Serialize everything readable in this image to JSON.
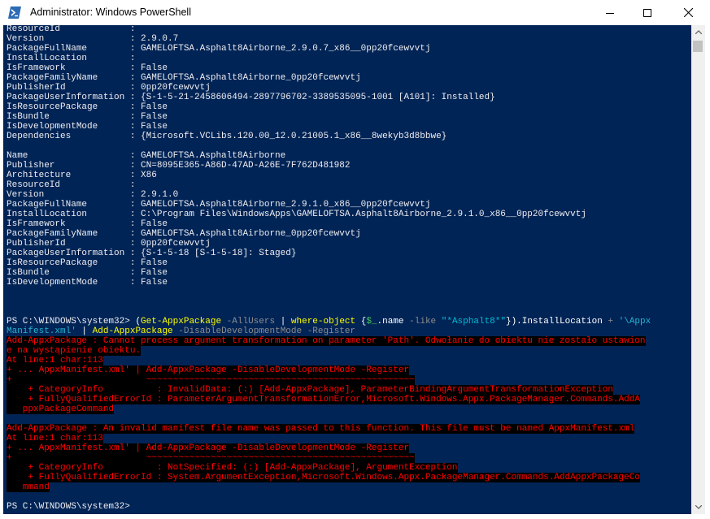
{
  "window": {
    "title": "Administrator: Windows PowerShell",
    "icon": "powershell-icon",
    "controls": {
      "minimize": "minimize-icon",
      "maximize": "maximize-icon",
      "close": "close-icon"
    }
  },
  "colors": {
    "console_bg": "#012456",
    "text": "#eeedf0",
    "error_fg": "#ff0000",
    "error_bg": "#000000",
    "cmdlet": "#ffff00",
    "parameter": "#8c8c8c",
    "string": "#00bcd4",
    "variable": "#44c35e"
  },
  "package1": {
    "lines": [
      "ResourceId             :",
      "Version                : 2.9.0.7",
      "PackageFullName        : GAMELOFTSA.Asphalt8Airborne_2.9.0.7_x86__0pp20fcewvvtj",
      "InstallLocation        :",
      "IsFramework            : False",
      "PackageFamilyName      : GAMELOFTSA.Asphalt8Airborne_0pp20fcewvvtj",
      "PublisherId            : 0pp20fcewvvtj",
      "PackageUserInformation : {S-1-5-21-2458606494-2897796702-3389535095-1001 [A101]: Installed}",
      "IsResourcePackage      : False",
      "IsBundle               : False",
      "IsDevelopmentMode      : False",
      "Dependencies           : {Microsoft.VCLibs.120.00_12.0.21005.1_x86__8wekyb3d8bbwe}"
    ]
  },
  "package2": {
    "lines": [
      "Name                   : GAMELOFTSA.Asphalt8Airborne",
      "Publisher              : CN=8095E365-A86D-47AD-A26E-7F762D481982",
      "Architecture           : X86",
      "ResourceId             :",
      "Version                : 2.9.1.0",
      "PackageFullName        : GAMELOFTSA.Asphalt8Airborne_2.9.1.0_x86__0pp20fcewvvtj",
      "InstallLocation        : C:\\Program Files\\WindowsApps\\GAMELOFTSA.Asphalt8Airborne_2.9.1.0_x86__0pp20fcewvvtj",
      "IsFramework            : False",
      "PackageFamilyName      : GAMELOFTSA.Asphalt8Airborne_0pp20fcewvvtj",
      "PublisherId            : 0pp20fcewvvtj",
      "PackageUserInformation : {S-1-5-18 [S-1-5-18]: Staged}",
      "IsResourcePackage      : False",
      "IsBundle               : False",
      "IsDevelopmentMode      : False"
    ]
  },
  "command": {
    "prompt": "PS C:\\WINDOWS\\system32> ",
    "open_paren": "(",
    "cmd1": "Get-AppxPackage",
    "param1": " -AllUsers",
    "pipe1": " | ",
    "cmd2": "where-object",
    "brace_open": " {",
    "var": "$_",
    "prop": ".name",
    "param2": " -like",
    "str1": " \"*Asphalt8*\"",
    "close_part": "}).InstallLocation",
    "plus": " + ",
    "str2a": "'\\Appx",
    "str2b": "Manifest.xml'",
    "pipe2": " | ",
    "cmd3": "Add-AppxPackage",
    "param3": " -DisableDevelopmentMode -Register"
  },
  "errors": [
    "Add-AppxPackage : Cannot process argument transformation on parameter 'Path'. Odwołanie do obiektu nie zostało ustawion",
    "e na wystąpienie obiektu.",
    "At line:1 char:113",
    "+ ... AppxManifest.xml' | Add-AppxPackage -DisableDevelopmentMode -Register",
    "+                         ~~~~~~~~~~~~~~~~~~~~~~~~~~~~~~~~~~~~~~~~~~~~~~~~~~",
    "    + CategoryInfo          : InvalidData: (:) [Add-AppxPackage], ParameterBindingArgumentTransformationException",
    "    + FullyQualifiedErrorId : ParameterArgumentTransformationError,Microsoft.Windows.Appx.PackageManager.Commands.AddA",
    "   ppxPackageCommand",
    "Add-AppxPackage : An invalid manifest file name was passed to this function. This file must be named AppxManifest.xml",
    "At line:1 char:113",
    "+ ... AppxManifest.xml' | Add-AppxPackage -DisableDevelopmentMode -Register",
    "+                         ~~~~~~~~~~~~~~~~~~~~~~~~~~~~~~~~~~~~~~~~~~~~~~~~~~",
    "    + CategoryInfo          : NotSpecified: (:) [Add-AppxPackage], ArgumentException",
    "    + FullyQualifiedErrorId : System.ArgumentException,Microsoft.Windows.Appx.PackageManager.Commands.AddAppxPackageCo",
    "   mmand"
  ],
  "final_prompt": "PS C:\\WINDOWS\\system32>"
}
